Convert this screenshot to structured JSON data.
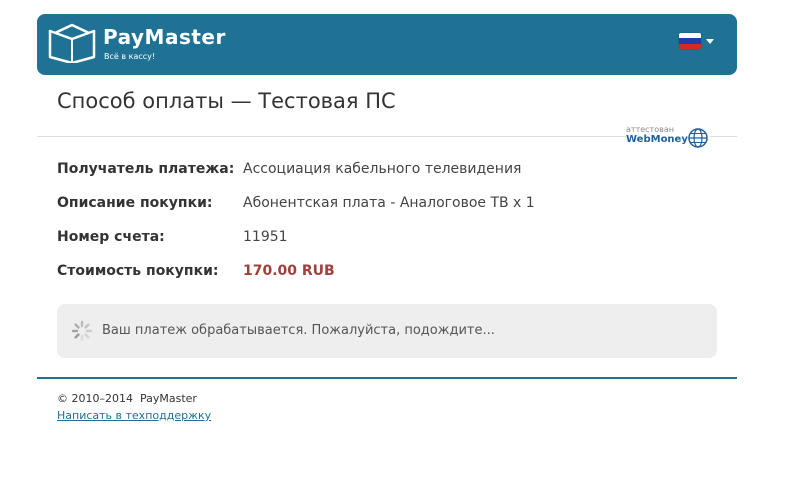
{
  "header": {
    "logo_name": "PayMaster",
    "logo_tagline": "Всё в кассу!",
    "language_flag": "ru-flag-icon",
    "colors": {
      "bar": "#1f7293"
    }
  },
  "title": "Способ оплаты — Тестовая ПС",
  "webmoney_badge": {
    "caption": "аттестован",
    "name": "WebMoney"
  },
  "payment_info": {
    "recipient_label": "Получатель платежа:",
    "recipient_value": "Ассоциация кабельного телевидения",
    "description_label": "Описание покупки:",
    "description_value": "Абонентская плата - Аналоговое ТВ x 1",
    "invoice_label": "Номер счета:",
    "invoice_value": "11951",
    "amount_label": "Стоимость покупки:",
    "amount_value": "170.00 RUB",
    "amount_color": "#a0403c"
  },
  "status": {
    "text": "Ваш платеж обрабатывается. Пожалуйста, подождите...",
    "icon": "loading-spinner-icon"
  },
  "footer": {
    "copyright": "© 2010–2014  PayMaster",
    "support_link": "Написать в техподдержку"
  }
}
